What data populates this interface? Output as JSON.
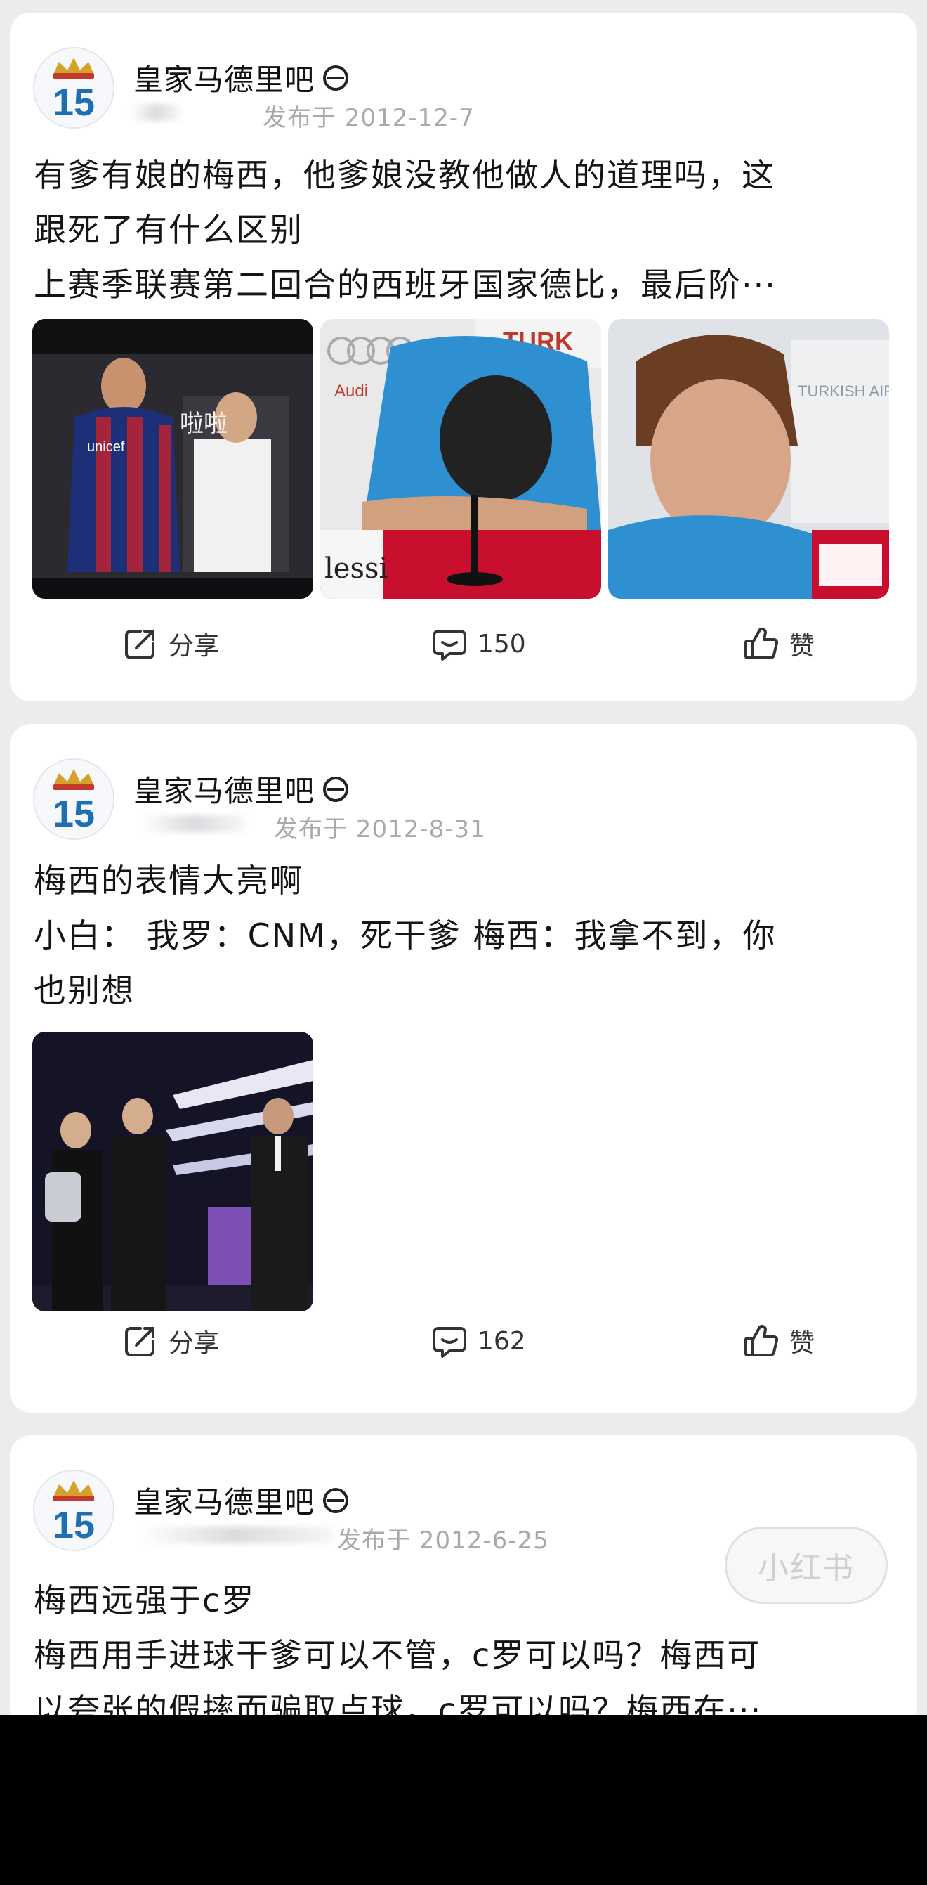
{
  "posts": [
    {
      "forum": "皇家马德里吧",
      "published": "发布于 2012-12-7",
      "lines": [
        "有爹有娘的梅西，他爹娘没教他做人的道理吗，这",
        "跟死了有什么区别",
        "上赛季联赛第二回合的西班牙国家德比，最后阶···"
      ],
      "image_texts": [
        "unicef",
        "啦啦",
        "lessi",
        "Audi",
        "TURK",
        "TURKISH AIRLINES"
      ],
      "share": "分享",
      "comments": "150",
      "like": "赞"
    },
    {
      "forum": "皇家马德里吧",
      "published": "发布于 2012-8-31",
      "lines": [
        "梅西的表情大亮啊",
        "小白： 我罗：CNM，死干爹 梅西：我拿不到，你",
        "也别想"
      ],
      "share": "分享",
      "comments": "162",
      "like": "赞"
    },
    {
      "forum": "皇家马德里吧",
      "published": "发布于 2012-6-25",
      "lines": [
        "梅西远强于c罗",
        "梅西用手进球干爹可以不管，c罗可以吗？梅西可",
        "以夸张的假摔而骗取点球，c罗可以吗？梅西在···"
      ]
    }
  ],
  "avatar_number": "15",
  "watermark": "小红书",
  "colors": {
    "page_bg": "#ececee",
    "card_bg": "#ffffff",
    "meta_gray": "#a8a8ae",
    "avatar_blue": "#1f6fb5",
    "crown_gold": "#d4a12a"
  },
  "icons": [
    "share-icon",
    "comment-icon",
    "like-icon",
    "level-icon",
    "crest-15-avatar"
  ]
}
